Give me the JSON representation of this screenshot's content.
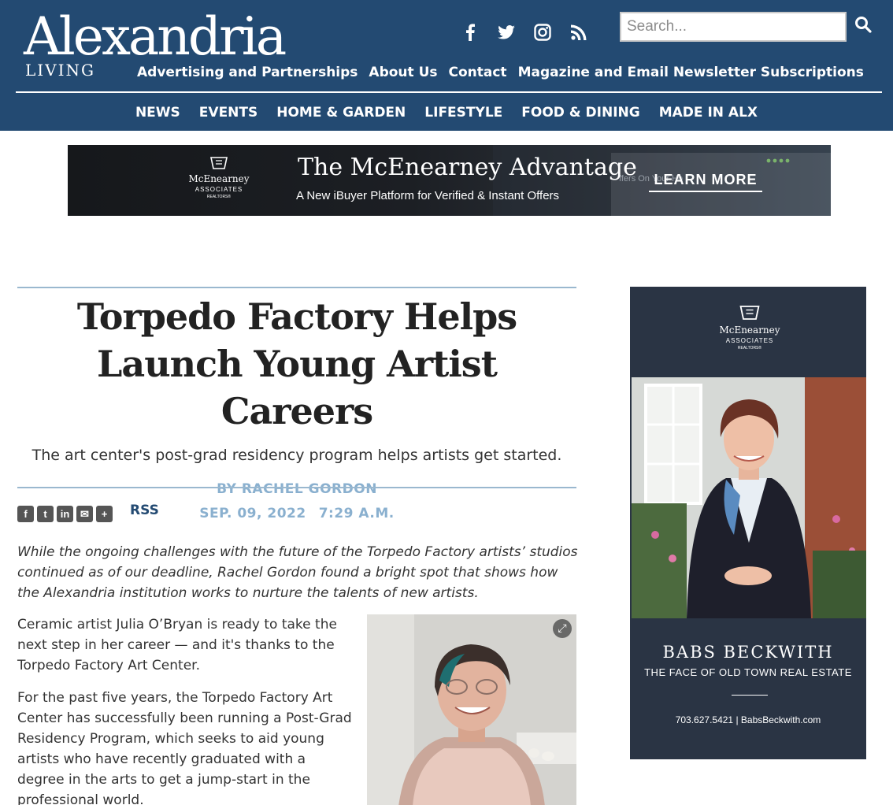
{
  "site": {
    "logo_main": "Alexandria",
    "logo_sub": "LIVING"
  },
  "header": {
    "search_placeholder": "Search...",
    "social": [
      {
        "icon": "facebook-icon",
        "glyph": "f"
      },
      {
        "icon": "twitter-icon",
        "glyph": "t"
      },
      {
        "icon": "instagram-icon",
        "glyph": "i"
      },
      {
        "icon": "rss-icon",
        "glyph": "r"
      }
    ],
    "util_nav": [
      "Advertising and Partnerships",
      "About Us",
      "Contact",
      "Magazine and Email Newsletter Subscriptions"
    ],
    "main_nav": [
      "NEWS",
      "EVENTS",
      "HOME & GARDEN",
      "LIFESTYLE",
      "FOOD & DINING",
      "MADE IN ALX"
    ]
  },
  "top_ad": {
    "brand_name": "McEnearney",
    "brand_assoc": "ASSOCIATES",
    "brand_realtors": "REALTORS®",
    "headline": "The McEnearney Advantage",
    "subhead": "A New iBuyer Platform for Verified & Instant Offers",
    "cta": "LEARN MORE",
    "bg_snippet": "ffers On Your Ho"
  },
  "article": {
    "title": "Torpedo Factory Helps Launch Young Artist Careers",
    "dek": "The art center's post-grad residency program helps artists get started.",
    "byline": "BY RACHEL GORDON",
    "date": "SEP. 09, 2022",
    "time": "7:29 A.M.",
    "share_buttons": [
      {
        "icon": "facebook-share-icon",
        "glyph": "f"
      },
      {
        "icon": "twitter-share-icon",
        "glyph": "t"
      },
      {
        "icon": "linkedin-share-icon",
        "glyph": "in"
      },
      {
        "icon": "email-share-icon",
        "glyph": "✉"
      },
      {
        "icon": "more-share-icon",
        "glyph": "+"
      }
    ],
    "rss_label": "RSS",
    "intro": "While the ongoing challenges with the future of the Torpedo Factory artists’ studios continued as of our deadline, Rachel Gordon found a bright spot that shows how the Alexandria institution works to nurture the talents of new artists.",
    "paragraphs": [
      "Ceramic artist Julia O’Bryan is ready to take the next step in her career — and it's thanks to the Torpedo Factory Art Center.",
      "For the past five years, the Torpedo Factory Art Center has successfully been running a Post-Grad Residency Program, which seeks to aid young artists who have recently graduated with a degree in the arts to get a jump-start in the professional world."
    ]
  },
  "side_ad": {
    "brand_name": "McEnearney",
    "brand_assoc": "ASSOCIATES",
    "brand_realtors": "REALTORS®",
    "name": "BABS BECKWITH",
    "tagline": "THE FACE OF OLD TOWN REAL ESTATE",
    "contact": "703.627.5421 | BabsBeckwith.com"
  },
  "colors": {
    "header_bg": "#234a72",
    "byline": "#8ab0cf",
    "rule": "#9ab8cf",
    "side_ad_bg": "#2a3444"
  }
}
